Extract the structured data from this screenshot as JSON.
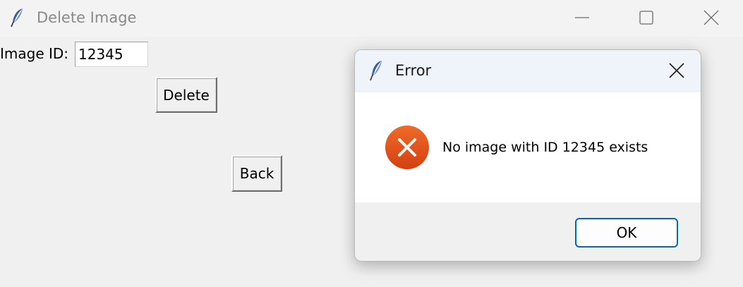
{
  "window": {
    "title": "Delete Image",
    "icon": "feather-icon",
    "controls": [
      "minimize-icon",
      "maximize-icon",
      "close-icon"
    ]
  },
  "form": {
    "image_id_label": "Image ID:",
    "image_id_value": "12345",
    "delete_label": "Delete",
    "back_label": "Back"
  },
  "dialog": {
    "title": "Error",
    "icon": "feather-icon",
    "status_icon": "error-icon",
    "message": "No image with ID 12345 exists",
    "ok_label": "OK"
  },
  "colors": {
    "error_red": "#e0501c",
    "accent_blue": "#0067c0",
    "window_bg": "#f0f0f0",
    "dialog_title_bg": "#eff3fa"
  }
}
